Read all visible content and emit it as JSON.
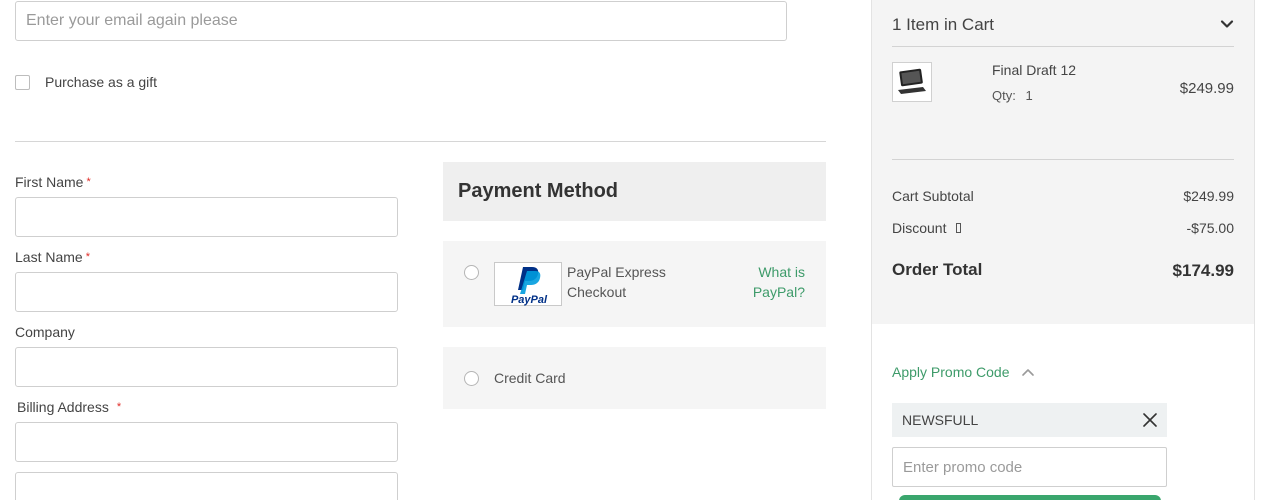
{
  "email": {
    "placeholder": "Enter your email again please",
    "value": ""
  },
  "gift": {
    "label": "Purchase as a gift",
    "checked": false
  },
  "billing": {
    "first_name_label": "First Name",
    "last_name_label": "Last Name",
    "company_label": "Company",
    "address_label": "Billing Address",
    "required_mark": "*"
  },
  "payment": {
    "title": "Payment Method",
    "paypal": {
      "logo_text": "PayPal",
      "line1": "PayPal Express",
      "line2": "Checkout",
      "help_line1": "What is",
      "help_line2": "PayPal?"
    },
    "credit_card_label": "Credit Card"
  },
  "summary": {
    "items_title": "1 Item in Cart",
    "item": {
      "name": "Final Draft 12",
      "qty_label": "Qty:",
      "qty": "1",
      "price": "$249.99"
    },
    "subtotal_label": "Cart Subtotal",
    "subtotal": "$249.99",
    "discount_label": "Discount",
    "discount": "-$75.00",
    "total_label": "Order Total",
    "total": "$174.99"
  },
  "promo": {
    "toggle_label": "Apply Promo Code",
    "applied_code": "NEWSFULL",
    "placeholder": "Enter promo code"
  },
  "colors": {
    "accent_green": "#3e9b6a",
    "required_red": "#e02b27",
    "paypal_blue": "#003087"
  }
}
